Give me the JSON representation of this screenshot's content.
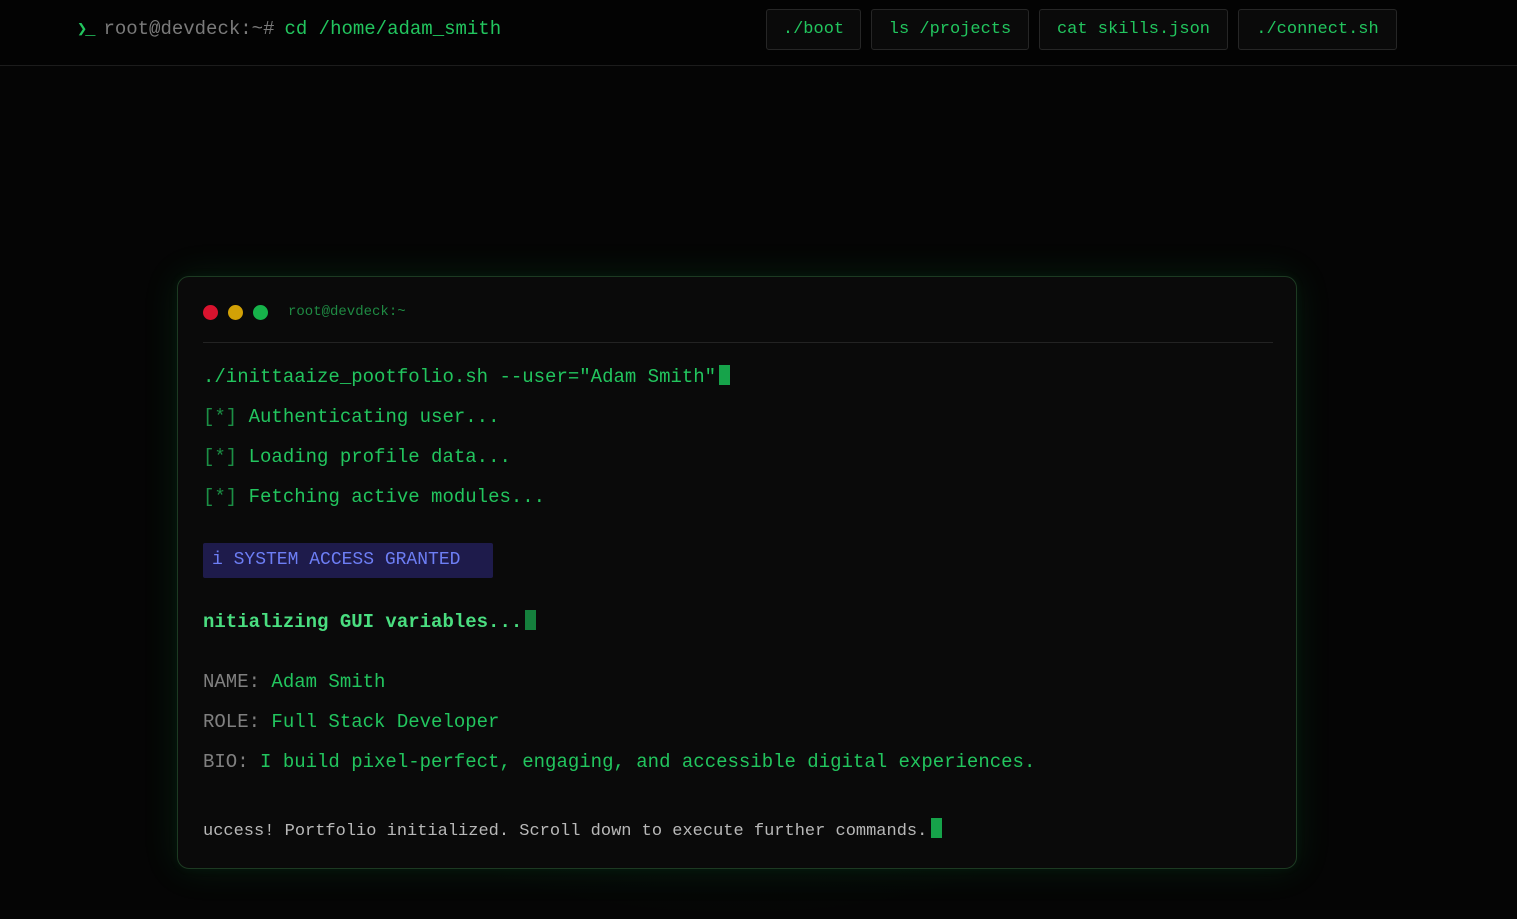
{
  "header": {
    "prompt_icon": "❯_",
    "prompt_host": "root@devdeck:~#",
    "prompt_command": "cd /home/adam_smith",
    "nav": [
      {
        "label": "./boot"
      },
      {
        "label": "ls /projects"
      },
      {
        "label": "cat skills.json"
      },
      {
        "label": "./connect.sh"
      }
    ]
  },
  "terminal": {
    "title": "root@devdeck:~",
    "command": "./inittaaize_pootfolio.sh --user=\"Adam Smith\"",
    "steps": [
      {
        "marker": "[*]",
        "text": "Authenticating user..."
      },
      {
        "marker": "[*]",
        "text": "Loading profile data..."
      },
      {
        "marker": "[*]",
        "text": "Fetching active modules..."
      }
    ],
    "access_badge": "i SYSTEM ACCESS GRANTED",
    "gui_init": "nitializing GUI variables...",
    "profile": {
      "name_key": "NAME:",
      "name_value": "Adam Smith",
      "role_key": "ROLE:",
      "role_value": "Full Stack Developer",
      "bio_key": "BIO:",
      "bio_value": "I build pixel-perfect, engaging, and accessible digital experiences."
    },
    "success": "uccess! Portfolio initialized. Scroll down to execute further commands."
  },
  "colors": {
    "accent_green": "#22c55e",
    "dot_red": "#d9132e",
    "dot_yellow": "#d2a106",
    "dot_green": "#16b34a",
    "badge_bg": "#1e1b4b",
    "badge_text": "#6d7ef5"
  }
}
